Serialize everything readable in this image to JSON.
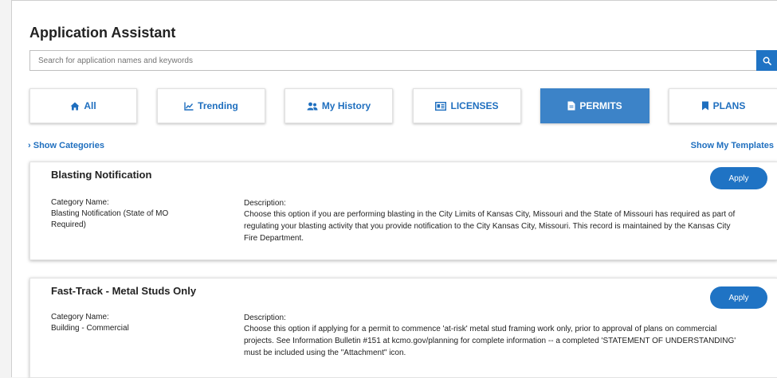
{
  "header": {
    "title": "Application Assistant"
  },
  "search": {
    "placeholder": "Search for application names and keywords",
    "button_icon": "search-icon"
  },
  "tabs": [
    {
      "label": "All",
      "icon": "home-icon",
      "active": false
    },
    {
      "label": "Trending",
      "icon": "line-chart-icon",
      "active": false
    },
    {
      "label": "My History",
      "icon": "users-icon",
      "active": false
    },
    {
      "label": "LICENSES",
      "icon": "id-card-icon",
      "active": false
    },
    {
      "label": "PERMITS",
      "icon": "document-icon",
      "active": true
    },
    {
      "label": "PLANS",
      "icon": "bookmark-icon",
      "active": false
    }
  ],
  "links": {
    "show_categories": "Show Categories",
    "show_templates": "Show My Templates"
  },
  "colors": {
    "accent": "#1f73c4",
    "active_tab": "#3c83c8",
    "link": "#1f6fbf"
  },
  "records": [
    {
      "title": "Blasting Notification",
      "apply_label": "Apply",
      "category_heading": "Category Name:",
      "category_value": "Blasting Notification (State of MO Required)",
      "description_heading": "Description:",
      "description": "Choose this option if you are performing blasting in the City Limits of Kansas City, Missouri and the State of Missouri has required as part of regulating your blasting activity that you provide notification to the City Kansas City, Missouri. This record is maintained by the Kansas City Fire Department."
    },
    {
      "title": "Fast-Track - Metal Studs Only",
      "apply_label": "Apply",
      "category_heading": "Category Name:",
      "category_value": "Building - Commercial",
      "description_heading": "Description:",
      "description": "Choose this option if applying for a permit to commence 'at-risk' metal stud framing work only, prior to approval of plans on commercial projects. See Information Bulletin #151 at kcmo.gov/planning for complete information -- a completed 'STATEMENT OF UNDERSTANDING' must be included using the \"Attachment\" icon."
    }
  ]
}
